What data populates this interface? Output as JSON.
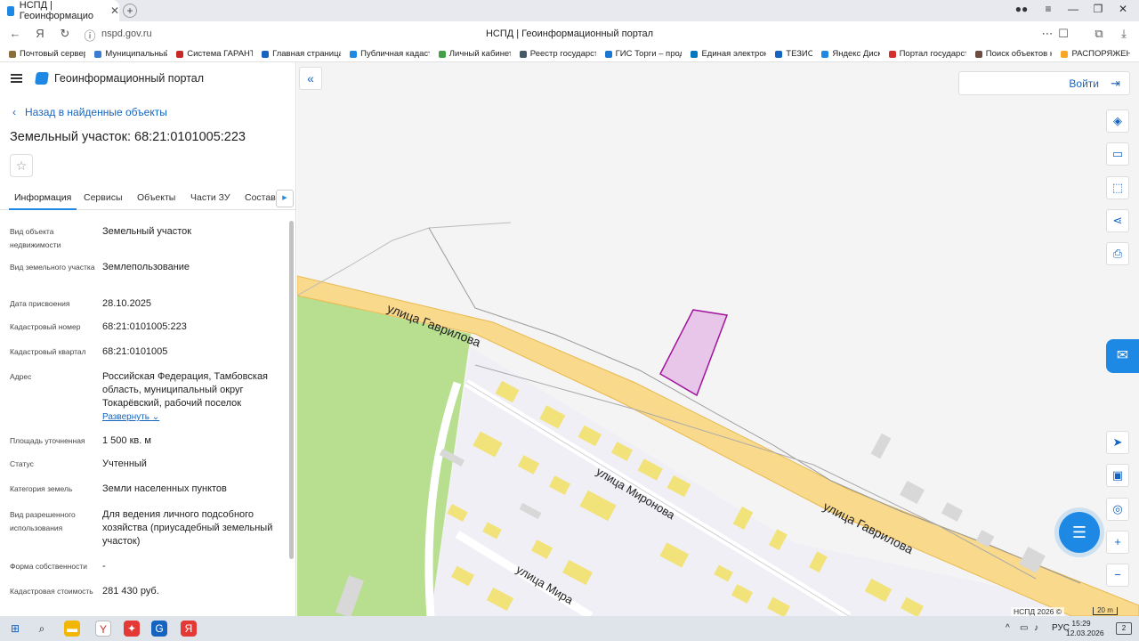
{
  "browser": {
    "tab_title": "НСПД | Геоинформацио",
    "tab_close": "✕",
    "new_tab": "+",
    "window_title": "НСПД | Геоинформационный портал",
    "url": "nspd.gov.ru",
    "bookmarks": [
      {
        "label": "Почтовый сервер",
        "color": "#8a6d3b"
      },
      {
        "label": "Муниципальный",
        "color": "#3a7bd5"
      },
      {
        "label": "Система ГАРАНТ",
        "color": "#c62828"
      },
      {
        "label": "Главная страница",
        "color": "#1565c0"
      },
      {
        "label": "Публичная кадаст",
        "color": "#1e88e5"
      },
      {
        "label": "Личный кабинет",
        "color": "#43a047"
      },
      {
        "label": "Реестр государст",
        "color": "#455a64"
      },
      {
        "label": "ГИС Торги – прод",
        "color": "#1976d2"
      },
      {
        "label": "Единая электрон",
        "color": "#0277bd"
      },
      {
        "label": "ТЕЗИС",
        "color": "#1565c0"
      },
      {
        "label": "Яндекс Диск",
        "color": "#1e88e5"
      },
      {
        "label": "Портал государст",
        "color": "#d32f2f"
      },
      {
        "label": "Поиск объектов н",
        "color": "#6d4c41"
      },
      {
        "label": "РАСПОРЯЖЕН",
        "color": "#f9a825"
      }
    ]
  },
  "panel": {
    "app_title": "Геоинформационный портал",
    "back_label": "Назад в найденные объекты",
    "object_title": "Земельный участок: 68:21:0101005:223",
    "tabs": [
      "Информация",
      "Сервисы",
      "Объекты",
      "Части ЗУ",
      "Состав"
    ],
    "fields": [
      {
        "label": "Вид объекта недвижимости",
        "value": "Земельный участок"
      },
      {
        "label": "Вид земельного участка",
        "value": "Землепользование"
      },
      {
        "label": "Дата присвоения",
        "value": "28.10.2025"
      },
      {
        "label": "Кадастровый номер",
        "value": "68:21:0101005:223"
      },
      {
        "label": "Кадастровый квартал",
        "value": "68:21:0101005"
      },
      {
        "label": "Адрес",
        "value": "Российская Федерация, Тамбовская область, муниципальный округ Токарёвский, рабочий поселок"
      },
      {
        "label": "Площадь уточненная",
        "value": "1 500 кв. м"
      },
      {
        "label": "Статус",
        "value": "Учтенный"
      },
      {
        "label": "Категория земель",
        "value": "Земли населенных пунктов"
      },
      {
        "label": "Вид разрешенного использования",
        "value": "Для ведения личного подсобного хозяйства (приусадебный земельный участок)"
      },
      {
        "label": "Форма собственности",
        "value": "-"
      },
      {
        "label": "Кадастровая стоимость",
        "value": "281 430 руб."
      }
    ],
    "expand_label": "Развернуть"
  },
  "map": {
    "login_label": "Войти",
    "streets": [
      "улица Гаврилова",
      "улица Гаврилова",
      "улица Миронова",
      "улица Мира"
    ],
    "attribution": "НСПД 2026 ©",
    "scale": "20 m",
    "colors": {
      "parcel_fill": "#e8c6ea",
      "parcel_stroke": "#a0149c",
      "road": "#f9d98b",
      "park": "#b8df90",
      "building": "#f2e27a"
    }
  },
  "taskbar": {
    "lang": "РУС",
    "time": "15:29",
    "date": "12.03.2026",
    "notif_count": "2"
  }
}
